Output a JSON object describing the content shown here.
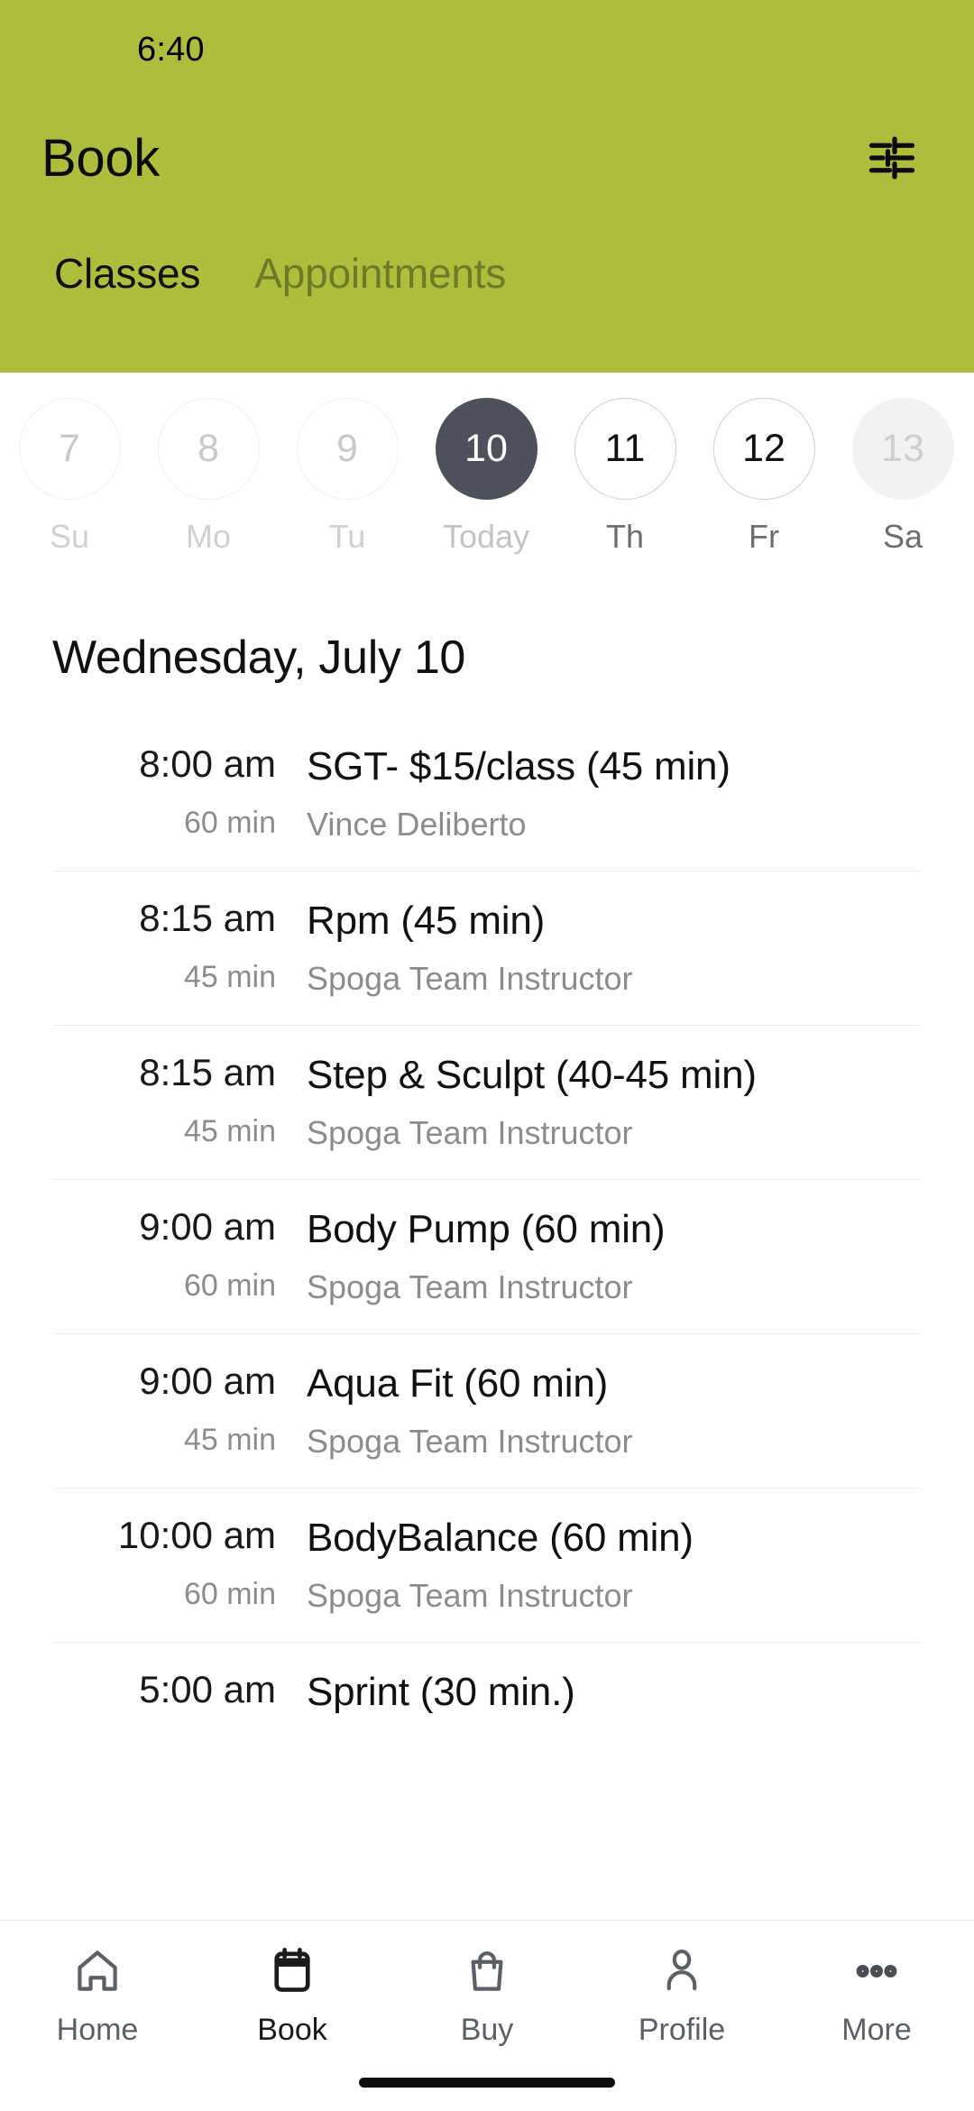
{
  "status_bar": {
    "time": "6:40"
  },
  "header": {
    "title": "Book",
    "filter_icon": "sliders-filter-icon",
    "accent_color": "#b0bd3c",
    "tabs": [
      {
        "label": "Classes",
        "active": true
      },
      {
        "label": "Appointments",
        "active": false
      }
    ]
  },
  "date_strip": {
    "days": [
      {
        "num": "7",
        "weekday": "Su",
        "state": "past"
      },
      {
        "num": "8",
        "weekday": "Mo",
        "state": "past"
      },
      {
        "num": "9",
        "weekday": "Tu",
        "state": "past"
      },
      {
        "num": "10",
        "weekday": "Today",
        "state": "selected"
      },
      {
        "num": "11",
        "weekday": "Th",
        "state": "future"
      },
      {
        "num": "12",
        "weekday": "Fr",
        "state": "future"
      },
      {
        "num": "13",
        "weekday": "Sa",
        "state": "edge"
      }
    ],
    "selected_color": "#4d515b"
  },
  "schedule": {
    "date_heading": "Wednesday, July 10",
    "classes": [
      {
        "time": "8:00 am",
        "duration": "60 min",
        "name": "SGT- $15/class (45 min)",
        "instructor": "Vince Deliberto"
      },
      {
        "time": "8:15 am",
        "duration": "45 min",
        "name": "Rpm (45 min)",
        "instructor": "Spoga Team Instructor"
      },
      {
        "time": "8:15 am",
        "duration": "45 min",
        "name": "Step & Sculpt (40-45 min)",
        "instructor": "Spoga Team Instructor"
      },
      {
        "time": "9:00 am",
        "duration": "60 min",
        "name": "Body Pump (60 min)",
        "instructor": "Spoga Team Instructor"
      },
      {
        "time": "9:00 am",
        "duration": "45 min",
        "name": "Aqua Fit (60 min)",
        "instructor": "Spoga Team Instructor"
      },
      {
        "time": "10:00 am",
        "duration": "60 min",
        "name": "BodyBalance (60 min)",
        "instructor": "Spoga Team Instructor"
      },
      {
        "time": "5:00 am",
        "duration": "",
        "name": "Sprint (30 min.)",
        "instructor": ""
      }
    ]
  },
  "bottom_nav": {
    "items": [
      {
        "label": "Home",
        "icon": "home-icon",
        "active": false
      },
      {
        "label": "Book",
        "icon": "calendar-icon",
        "active": true
      },
      {
        "label": "Buy",
        "icon": "bag-icon",
        "active": false
      },
      {
        "label": "Profile",
        "icon": "person-icon",
        "active": false
      },
      {
        "label": "More",
        "icon": "ellipsis-icon",
        "active": false
      }
    ]
  }
}
